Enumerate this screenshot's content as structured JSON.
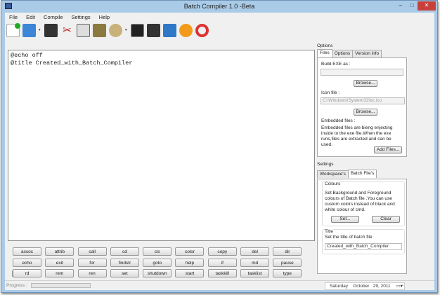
{
  "window": {
    "title": "Batch Compiler 1.0 -Beta",
    "minimize": "–",
    "maximize": "□",
    "close": "✕"
  },
  "menu": [
    "File",
    "Edit",
    "Compile",
    "Settings",
    "Help"
  ],
  "toolbar": [
    "new-file",
    "print",
    "save",
    "cut",
    "copy",
    "paste",
    "compile-settings",
    "console",
    "run",
    "exe",
    "info",
    "help"
  ],
  "editor": {
    "lines": [
      "@echo off",
      "@title Created_with_Batch_Compiler"
    ]
  },
  "scroll_left": "<",
  "commands": [
    "assoc",
    "attrib",
    "call",
    "cd",
    "cls",
    "color",
    "copy",
    "del",
    "dir",
    "echo",
    "exit",
    "for",
    "findstr",
    "goto",
    "help",
    "if",
    "md",
    "pause",
    "rd",
    "rem",
    "ren",
    "set",
    "shutdown",
    "start",
    "taskkill",
    "tasklist",
    "type"
  ],
  "status": {
    "progress_label": "Progress :",
    "progress": 0,
    "date": "Saturday    October   29, 2011"
  },
  "options": {
    "label": "Options",
    "tabs": [
      "Files",
      "Options",
      "Version info"
    ],
    "build_exe_label": "Build EXE as :",
    "build_exe_value": "",
    "browse1": "Browse...",
    "icon_label": "Icon file :",
    "icon_value": "C:\\Windows\\System32\\bc.ico",
    "browse2": "Browse...",
    "embedded_label": "Embedded files :",
    "embedded_desc": "Embedded files are bieng enjecting inside to the exe file.When the exe runs,files are extracted and can be used.",
    "add_files": "Add Files..."
  },
  "settings": {
    "label": "Settings",
    "tabs": [
      "Workspace's",
      "Batch File's"
    ],
    "colours_label": "Colours",
    "colours_desc": "Set Background and Foreground colours of Batch file .You can use custom colors instead of black and white colour of cmd.",
    "set": "Set...",
    "clear": "Clear",
    "title_label": "Title",
    "title_desc": "Set the title of batch file",
    "title_value": "Created_with_Batch_Compiler"
  }
}
